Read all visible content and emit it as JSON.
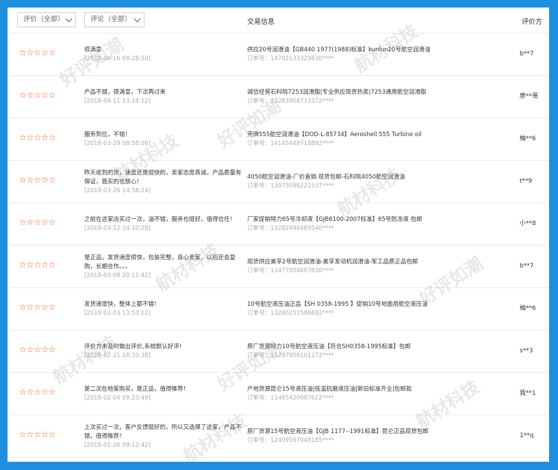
{
  "header": {
    "rating_filter": "评价（全部）",
    "comment_filter": "评论（全部）",
    "trade_info": "交易信息",
    "rater": "评价方"
  },
  "stars": "☆☆☆☆☆",
  "reviews": [
    {
      "comment": "很满意",
      "date": "[2018-04-16 09:28:50]",
      "product": "供应20号润滑油【GB440 1977(1988)标准】kunlun20号航空润滑油",
      "order": "订单号：14702133329630****",
      "rater": "b**7"
    },
    {
      "comment": "产品不错，很满意，下次再过来",
      "date": "[2018-04-11 13:18:12]",
      "product": "诚信经营石科院7253润滑脂|专业供应现货热卖|7253通用航空润滑脂",
      "order": "订单号：13283908713372****",
      "rater": "廖**哥"
    },
    {
      "comment": "服务到位，不错！",
      "date": "[2018-03-29 08:58:08]",
      "product": "壳牌555航空润滑油【DOD-L-85734】Aeroshell 555 Turbine oil",
      "order": "订单号：14145448718892****",
      "rater": "柚**6"
    },
    {
      "comment": "昨天收到的货，速度还是挺快的，卖家态度真诚，产品质量有保证，我买的也放心！",
      "date": "[2018-03-26 14:58:24]",
      "product": "4050航空润滑油-厂价直销 现货包邮-石科院4050航空润滑油",
      "order": "订单号：13975099221537****",
      "rater": "t**9"
    },
    {
      "comment": "之前在这家店买过一次，油不错，服务也挺好，值得信任！",
      "date": "[2018-03-12 14:10:28]",
      "product": "厂家促销特力65号冷却液【GJB6100-2007标准】65号防冻液 包邮",
      "order": "订单号：13282940465540****",
      "rater": "小**8"
    },
    {
      "comment": "是正品，发货速度很快，包装完整，良心卖家，以后还会复购，长期合作。。。",
      "date": "[2018-03-08 20:11:42]",
      "product": "现货供应美孚2号航空润滑油-美孚发动机润滑油-军工品质正品包邮",
      "order": "订单号：13477004667830****",
      "rater": "b**7"
    },
    {
      "comment": "发货速度快，整体上都不错！",
      "date": "[2018-03-03 13:53:12]",
      "product": "10号航空液压油正品【SH 0358-1995 】促销10号地面用航空液压油",
      "order": "订单号：13280251586692****",
      "rater": "柚**6"
    },
    {
      "comment": "评价方未及时做出评价,系统默认好评!",
      "date": "[2018-02-21 18:33:38]",
      "product": "原厂货源特力10号航空液压油【符合SH0358-1995标准】包邮",
      "order": "订单号：11297956101172****",
      "rater": "s**3"
    },
    {
      "comment": "第二次在他家购买，是正品，值得推荐！",
      "date": "[2018-02-04 09:23:49]",
      "product": "产地货源昆仑15号液压油|低温抗磨液压油|新旧标准齐全|包邮款",
      "order": "订单号：11465420687622****",
      "rater": "我**1"
    },
    {
      "comment": "上次买过一次，客户反馈挺好的，所以又选择了这家，产品不错，值得推荐！",
      "date": "[2018-01-26 09:12:42]",
      "product": "原厂货源15号航空液压油【GJB 1177--1991标准】昆仑正品现货包邮",
      "order": "订单号：12409597048185****",
      "rater": "1**q"
    }
  ],
  "watermarks": [
    "好评如潮",
    "航材科技"
  ]
}
